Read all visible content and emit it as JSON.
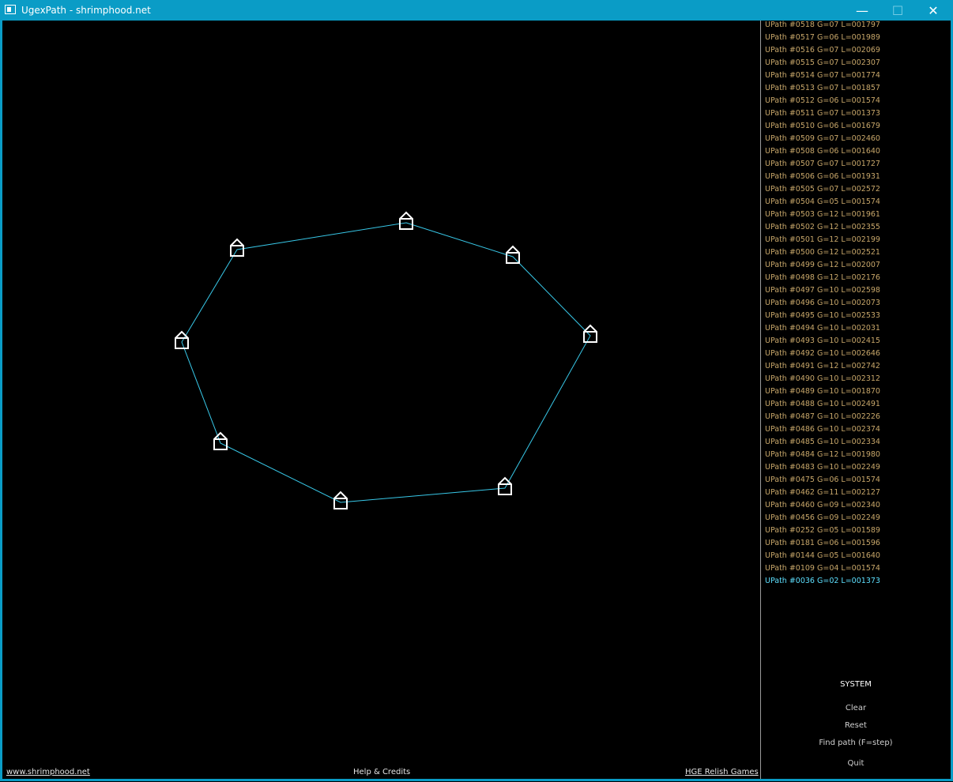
{
  "window": {
    "title": "UgexPath - shrimphood.net",
    "controls": {
      "minimize": "—",
      "maximize": "☐",
      "close": "✕"
    }
  },
  "colors": {
    "titlebar": "#0a9cc6",
    "path_text": "#c8a76a",
    "selected_path": "#5ee0ff",
    "path_line": "#38c8e8"
  },
  "path_list": [
    "UPath #0518 G=07 L=001797",
    "UPath #0517 G=06 L=001989",
    "UPath #0516 G=07 L=002069",
    "UPath #0515 G=07 L=002307",
    "UPath #0514 G=07 L=001774",
    "UPath #0513 G=07 L=001857",
    "UPath #0512 G=06 L=001574",
    "UPath #0511 G=07 L=001373",
    "UPath #0510 G=06 L=001679",
    "UPath #0509 G=07 L=002460",
    "UPath #0508 G=06 L=001640",
    "UPath #0507 G=07 L=001727",
    "UPath #0506 G=06 L=001931",
    "UPath #0505 G=07 L=002572",
    "UPath #0504 G=05 L=001574",
    "UPath #0503 G=12 L=001961",
    "UPath #0502 G=12 L=002355",
    "UPath #0501 G=12 L=002199",
    "UPath #0500 G=12 L=002521",
    "UPath #0499 G=12 L=002007",
    "UPath #0498 G=12 L=002176",
    "UPath #0497 G=10 L=002598",
    "UPath #0496 G=10 L=002073",
    "UPath #0495 G=10 L=002533",
    "UPath #0494 G=10 L=002031",
    "UPath #0493 G=10 L=002415",
    "UPath #0492 G=10 L=002646",
    "UPath #0491 G=12 L=002742",
    "UPath #0490 G=10 L=002312",
    "UPath #0489 G=10 L=001870",
    "UPath #0488 G=10 L=002491",
    "UPath #0487 G=10 L=002226",
    "UPath #0486 G=10 L=002374",
    "UPath #0485 G=10 L=002334",
    "UPath #0484 G=12 L=001980",
    "UPath #0483 G=10 L=002249",
    "UPath #0475 G=06 L=001574",
    "UPath #0462 G=11 L=002127",
    "UPath #0460 G=09 L=002340",
    "UPath #0456 G=09 L=002249",
    "UPath #0252 G=05 L=001589",
    "UPath #0181 G=06 L=001596",
    "UPath #0144 G=05 L=001640",
    "UPath #0109 G=04 L=001574",
    "UPath #0036 G=02 L=001373"
  ],
  "selected_path_index": 44,
  "system": {
    "title": "SYSTEM",
    "clear": "Clear",
    "reset": "Reset",
    "find_path": "Find path (F=step)",
    "quit": "Quit"
  },
  "footer": {
    "left_link": "www.shrimphood.net",
    "center": "Help & Credits",
    "right_link": "HGE Relish Games"
  }
}
